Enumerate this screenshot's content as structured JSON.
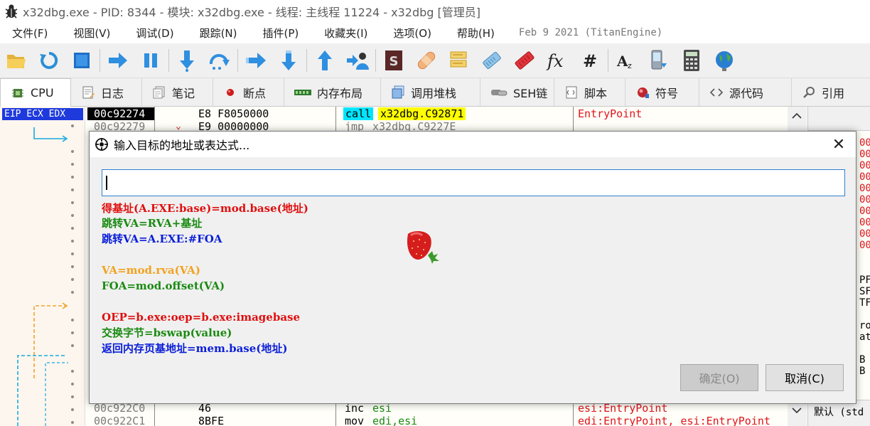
{
  "window": {
    "title": "x32dbg.exe - PID: 8344 - 模块: x32dbg.exe - 线程: 主线程 11224 - x32dbg [管理员]",
    "icon": "bug-icon"
  },
  "menu": {
    "items": [
      "文件(F)",
      "视图(V)",
      "调试(D)",
      "跟踪(N)",
      "插件(P)",
      "收藏夹(I)",
      "选项(O)",
      "帮助(H)"
    ],
    "build_date": "Feb 9 2021 (TitanEngine)"
  },
  "toolbar": {
    "buttons": [
      "open-folder-icon",
      "restart-icon",
      "stop-icon",
      "run-icon",
      "pause-icon",
      "step-into-icon",
      "step-over-icon",
      "trace-into-icon",
      "trace-over-icon",
      "execute-till-return-icon",
      "run-to-user-code-icon",
      "scylla-icon",
      "patch-icon",
      "comments-icon",
      "labels-icon",
      "bookmarks-icon",
      "functions-icon",
      "hash-icon",
      "strings-icon",
      "device-icon",
      "calculator-icon",
      "globe-icon"
    ]
  },
  "tabs": [
    {
      "label": "CPU",
      "icon": "cpu-icon",
      "active": true
    },
    {
      "label": "日志",
      "icon": "log-icon"
    },
    {
      "label": "笔记",
      "icon": "notes-icon"
    },
    {
      "label": "断点",
      "icon": "breakpoint-icon"
    },
    {
      "label": "内存布局",
      "icon": "memory-icon"
    },
    {
      "label": "调用堆栈",
      "icon": "callstack-icon"
    },
    {
      "label": "SEH链",
      "icon": "seh-icon"
    },
    {
      "label": "脚本",
      "icon": "script-icon"
    },
    {
      "label": "符号",
      "icon": "symbol-icon"
    },
    {
      "label": "源代码",
      "icon": "source-icon"
    },
    {
      "label": "引用",
      "icon": "search-icon"
    }
  ],
  "cpu": {
    "register_label": "EIP ECX EDX",
    "rows": [
      {
        "addr": "00c92274",
        "bytes": "E8 F8050000",
        "instr": "call",
        "operand": "x32dbg.C92871",
        "comment": "EntryPoint"
      },
      {
        "addr": "00c92279",
        "bytes": "E9 00000000",
        "instr": "jmp",
        "operand": "x32dbg.C9227E",
        "comment": ""
      },
      {
        "addr": "00c922C0",
        "bytes": "46",
        "instr": "inc",
        "operand": "esi",
        "comment": "esi:EntryPoint"
      },
      {
        "addr": "00c922C1",
        "bytes": "8BFE",
        "instr": "mov",
        "operand": "edi,esi",
        "comment": "edi:EntryPoint, esi:EntryPoint"
      }
    ],
    "right_panel": {
      "fragments": [
        "00",
        "00",
        "00",
        "00",
        "00",
        "00",
        "00",
        "00",
        "00",
        "00",
        "PF",
        "SF",
        "TF",
        "ro",
        "at",
        "B",
        "B"
      ],
      "footer": "默认 (std"
    }
  },
  "dialog": {
    "title": "输入目标的地址或表达式...",
    "input_value": "",
    "hints": [
      {
        "text": "得基址(A.EXE:base)=mod.base(地址)",
        "color": "red"
      },
      {
        "text": "跳转VA=RVA+基址",
        "color": "green"
      },
      {
        "text": "跳转VA=A.EXE:#FOA",
        "color": "blue"
      },
      {
        "text": "VA=mod.rva(VA)",
        "color": "orange"
      },
      {
        "text": "FOA=mod.offset(VA)",
        "color": "green"
      },
      {
        "text": "OEP=b.exe:oep=b.exe:imagebase",
        "color": "red"
      },
      {
        "text": "交换字节=bswap(value)",
        "color": "green"
      },
      {
        "text": "返回内存页基地址=mem.base(地址)",
        "color": "blue"
      }
    ],
    "ok_label": "确定(O)",
    "cancel_label": "取消(C)"
  }
}
